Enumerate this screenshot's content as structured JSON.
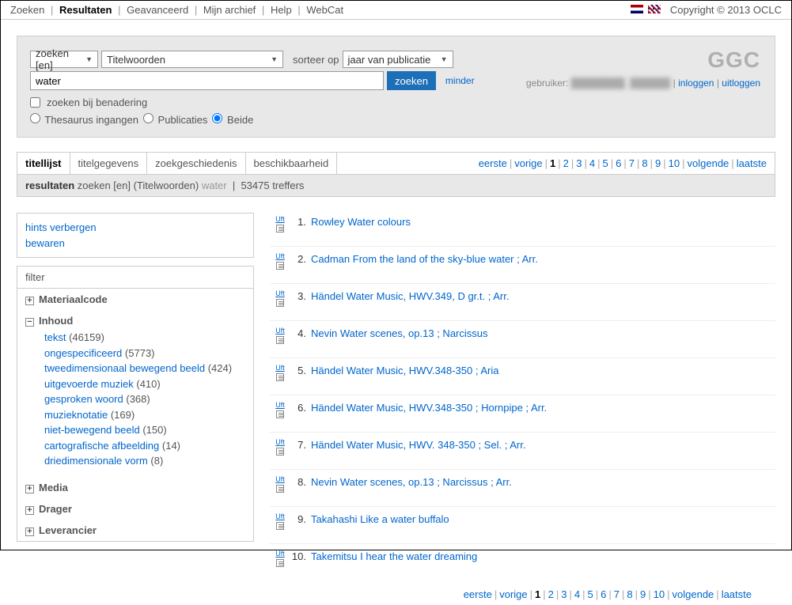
{
  "topnav": {
    "items": [
      "Zoeken",
      "Resultaten",
      "Geavanceerd",
      "Mijn archief",
      "Help",
      "WebCat"
    ],
    "active": 1,
    "copyright": "Copyright © 2013 OCLC"
  },
  "search": {
    "mode_dd": "zoeken [en]",
    "field_dd": "Titelwoorden",
    "sort_label": "sorteer op",
    "sort_dd": "jaar van publicatie",
    "query": "water",
    "button": "zoeken",
    "minder": "minder",
    "logo": "GGC",
    "approx_label": "zoeken bij benadering",
    "thesaurus": "Thesaurus ingangen",
    "publicaties": "Publicaties",
    "beide": "Beide",
    "user_label": "gebruiker:",
    "user_blur": "████████, ██████",
    "inloggen": "inloggen",
    "uitloggen": "uitloggen"
  },
  "tabs": {
    "items": [
      "titellijst",
      "titelgegevens",
      "zoekgeschiedenis",
      "beschikbaarheid"
    ],
    "active": 0
  },
  "pager": {
    "first": "eerste",
    "prev": "vorige",
    "pages": [
      "1",
      "2",
      "3",
      "4",
      "5",
      "6",
      "7",
      "8",
      "9",
      "10"
    ],
    "current": "1",
    "next": "volgende",
    "last": "laatste"
  },
  "summary": {
    "label": "resultaten",
    "scope": "zoeken [en] (Titelwoorden)",
    "query": "water",
    "hits": "53475 treffers"
  },
  "links": {
    "hide": "hints verbergen",
    "save": "bewaren"
  },
  "filter": {
    "header": "filter",
    "facets": [
      {
        "name": "Materiaalcode",
        "open": false
      },
      {
        "name": "Inhoud",
        "open": true,
        "values": [
          {
            "label": "tekst",
            "count": "(46159)"
          },
          {
            "label": "ongespecificeerd",
            "count": "(5773)"
          },
          {
            "label": "tweedimensionaal bewegend beeld",
            "count": "(424)"
          },
          {
            "label": "uitgevoerde muziek",
            "count": "(410)"
          },
          {
            "label": "gesproken woord",
            "count": "(368)"
          },
          {
            "label": "muzieknotatie",
            "count": "(169)"
          },
          {
            "label": "niet-bewegend beeld",
            "count": "(150)"
          },
          {
            "label": "cartografische afbeelding",
            "count": "(14)"
          },
          {
            "label": "driedimensionale vorm",
            "count": "(8)"
          }
        ]
      },
      {
        "name": "Media",
        "open": false
      },
      {
        "name": "Drager",
        "open": false
      },
      {
        "name": "Leverancier",
        "open": false
      }
    ],
    "uft": "Uft"
  },
  "results": [
    {
      "n": "1.",
      "title": "Rowley Water colours"
    },
    {
      "n": "2.",
      "title": "Cadman From the land of the sky-blue water ; Arr."
    },
    {
      "n": "3.",
      "title": "Händel Water Music, HWV.349, D gr.t. ; Arr."
    },
    {
      "n": "4.",
      "title": "Nevin Water scenes, op.13 ; Narcissus"
    },
    {
      "n": "5.",
      "title": "Händel Water Music, HWV.348-350 ; Aria"
    },
    {
      "n": "6.",
      "title": "Händel Water Music, HWV.348-350 ; Hornpipe ; Arr."
    },
    {
      "n": "7.",
      "title": "Händel Water Music, HWV. 348-350 ; Sel. ; Arr."
    },
    {
      "n": "8.",
      "title": "Nevin Water scenes, op.13 ; Narcissus ; Arr."
    },
    {
      "n": "9.",
      "title": "Takahashi Like a water buffalo"
    },
    {
      "n": "10.",
      "title": "Takemitsu I hear the water dreaming"
    }
  ]
}
